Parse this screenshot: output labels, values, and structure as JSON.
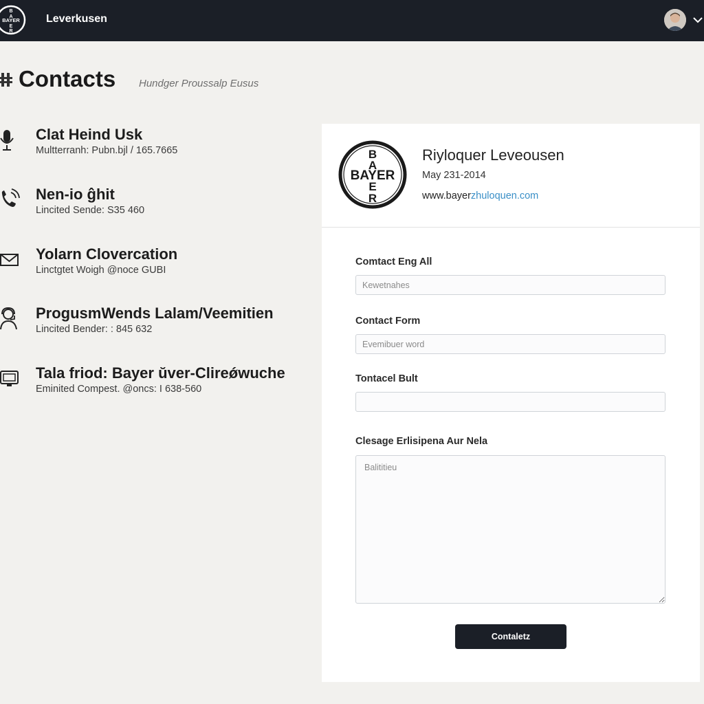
{
  "header": {
    "app_title": "Leverkusen",
    "logo_text": "BAYER",
    "avatar": "user-avatar",
    "menu_icon": "chevron-down-icon"
  },
  "page": {
    "title": "Contacts",
    "subtitle": "Hundger Proussalp Eusus"
  },
  "contacts": [
    {
      "name": "Clat Heind Usk",
      "detail": "Multterranh: Pubn.bjl / 165.7665",
      "icon": "microphone-icon"
    },
    {
      "name": "Nen-io ĝhit",
      "detail": "Lincited Sende: S35 460",
      "icon": "phone-icon"
    },
    {
      "name": "Yolarn Clovercation",
      "detail": "Linctgtet Woigh @noce GUBI",
      "icon": "envelope-icon"
    },
    {
      "name": "ProgusmWends Lalam/Veemitien",
      "detail": "Lincited Bender: : 845 632",
      "icon": "support-agent-icon"
    },
    {
      "name": "Tala friod: Bayer ŭver-Clireǿwuche",
      "detail": "Eminited Compest. @oncs: I 638-560",
      "icon": "monitor-icon"
    }
  ],
  "card": {
    "logo_text": "BAYER",
    "name": "Riyloquer Leveousen",
    "date": "May 231-2014",
    "url_part1": "www.bayer",
    "url_part2": "zhuloquen.com",
    "fields": [
      {
        "label": "Comtact Eng All",
        "placeholder": "Kewetnahes",
        "value": ""
      },
      {
        "label": "Contact Form",
        "placeholder": "Evemibuer word",
        "value": ""
      },
      {
        "label": "Tontacel Bult",
        "placeholder": "",
        "value": ""
      }
    ],
    "message": {
      "label": "Clesage Erlisipena Aur Nela",
      "placeholder": "Balititieu"
    },
    "submit_label": "Contaletz"
  },
  "colors": {
    "header_bg": "#1b1f27",
    "page_bg": "#f2f1ee",
    "link_accent": "#3a8fc7",
    "button_bg": "#1b1f27"
  }
}
